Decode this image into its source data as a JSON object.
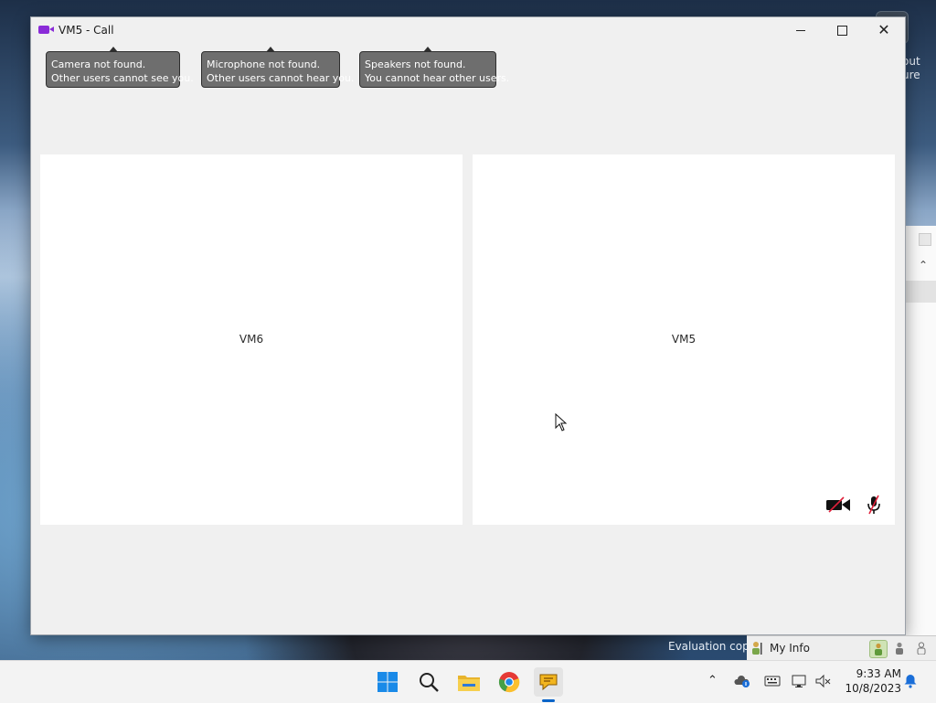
{
  "window": {
    "title": "VM5 - Call"
  },
  "tooltips": {
    "camera": {
      "line1": "Camera not found.",
      "line2": "Other users cannot see you."
    },
    "microphone": {
      "line1": "Microphone not found.",
      "line2": "Other users cannot hear you."
    },
    "speakers": {
      "line1": "Speakers not found.",
      "line2": "You cannot hear other users."
    }
  },
  "panes": {
    "remote": {
      "label": "VM6"
    },
    "local": {
      "label": "VM5"
    }
  },
  "background": {
    "partial_text_1": "out",
    "partial_text_2": "ure",
    "evaluation_text": "Evaluation copy",
    "my_info_label": "My Info"
  },
  "taskbar": {
    "time": "9:33 AM",
    "date": "10/8/2023"
  },
  "colors": {
    "app_accent": "#8a2bd8",
    "tooltip_bg": "#6e6e6e",
    "muted_slash": "#e0203a",
    "taskbar_active": "#0a64c8"
  }
}
